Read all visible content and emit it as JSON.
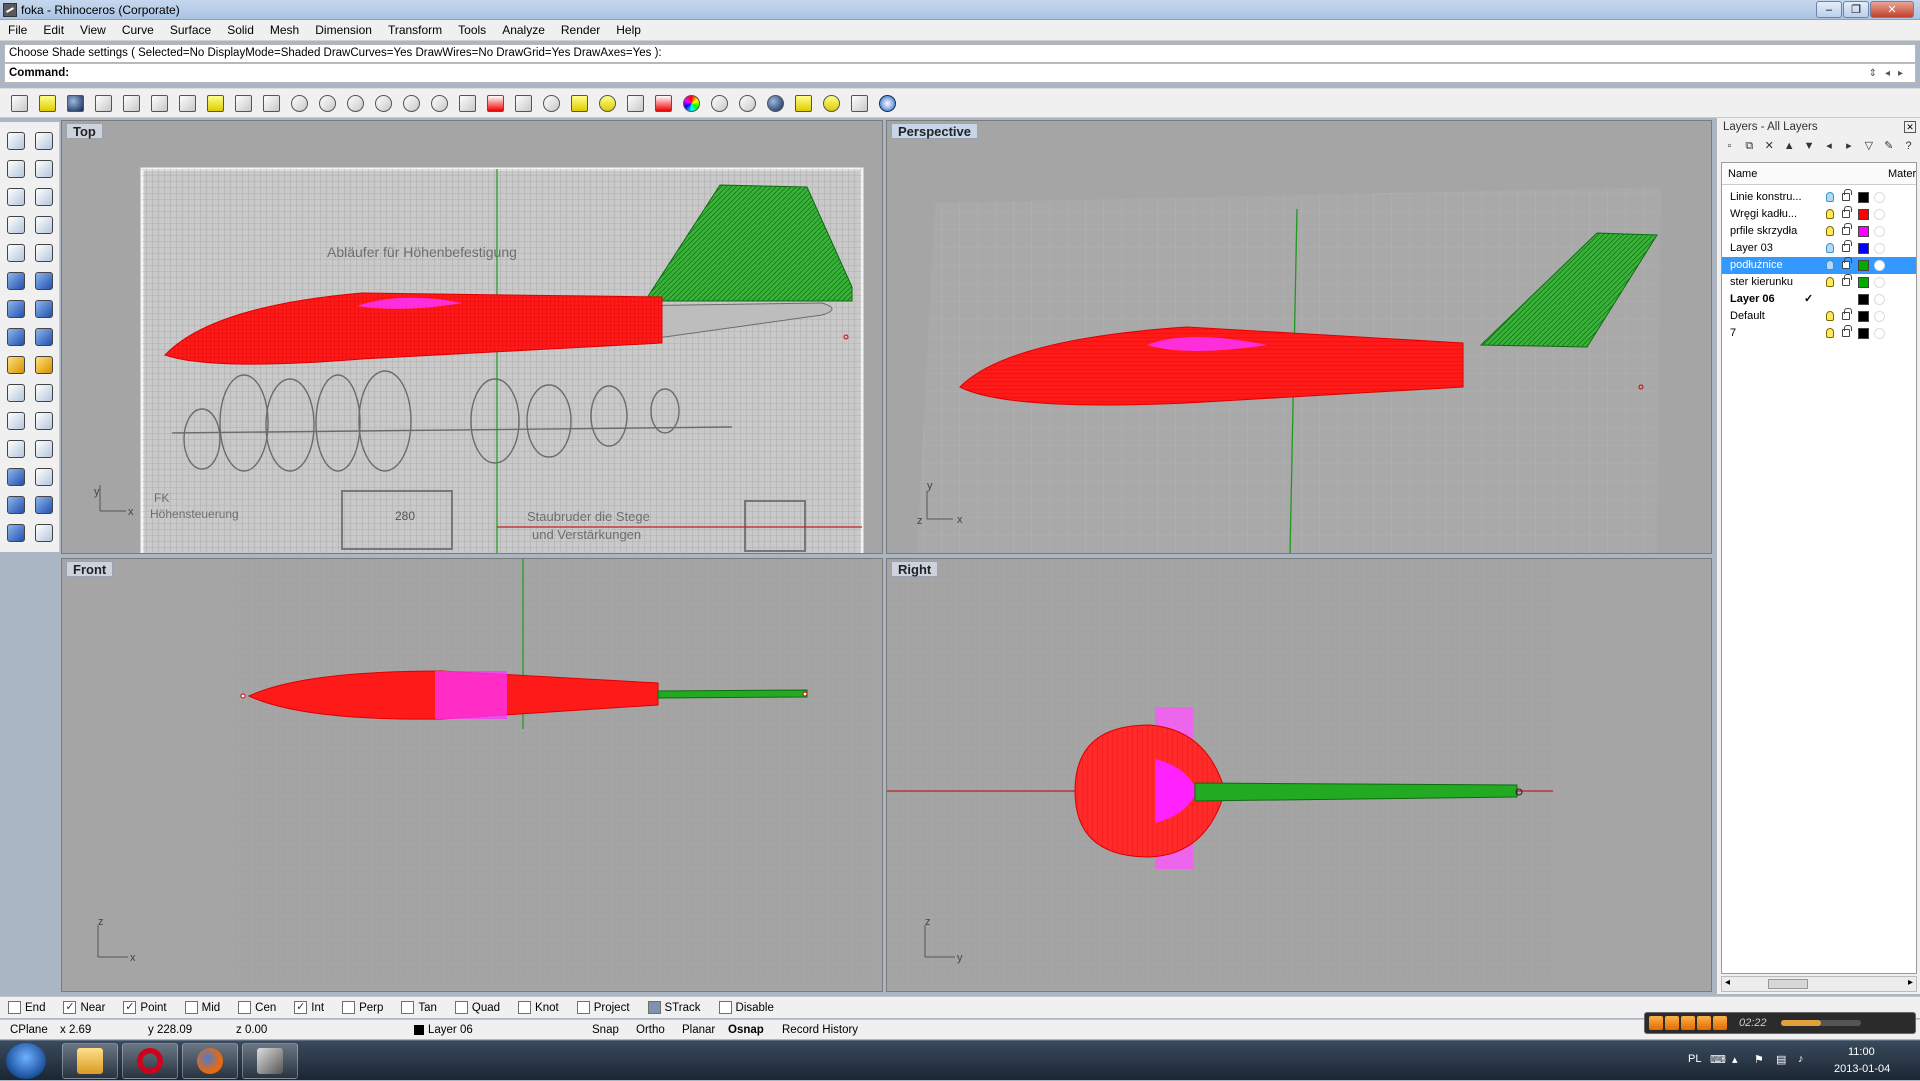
{
  "window": {
    "title": "foka - Rhinoceros (Corporate)",
    "controls": [
      "–",
      "❐",
      "✕"
    ]
  },
  "menu": [
    "File",
    "Edit",
    "View",
    "Curve",
    "Surface",
    "Solid",
    "Mesh",
    "Dimension",
    "Transform",
    "Tools",
    "Analyze",
    "Render",
    "Help"
  ],
  "command": {
    "history": "Choose Shade settings ( Selected=No  DisplayMode=Shaded  DrawCurves=Yes  DrawWires=No  DrawGrid=Yes  DrawAxes=Yes ):",
    "prompt": "Command:"
  },
  "viewports": {
    "top": {
      "label": "Top",
      "axes": [
        "y",
        "x"
      ],
      "blueprint_title": "Abläufer für Höhenbefestigung",
      "blueprint_note1": "FK",
      "blueprint_note2": "Höhensteuerung",
      "blueprint_note3": "Staubruder die Stege",
      "blueprint_note4": "und Verstärkungen",
      "blueprint_dim": "280"
    },
    "perspective": {
      "label": "Perspective",
      "axes": [
        "y",
        "z",
        "x"
      ]
    },
    "front": {
      "label": "Front",
      "axes": [
        "z",
        "x"
      ]
    },
    "right": {
      "label": "Right",
      "axes": [
        "z",
        "y"
      ]
    }
  },
  "colors": {
    "fuselage": "#ff1a1a",
    "fin": "#22aa22",
    "wing": "#ff22ff",
    "viewport_bg": "#a5a5a5",
    "grid": "#b8b8b8",
    "selection": "#3399ff"
  },
  "layers": {
    "title": "Layers - All Layers",
    "columns": {
      "name": "Name",
      "material": "Mater"
    },
    "rows": [
      {
        "name": "Linie konstru...",
        "color": "#000000",
        "bulb": "off",
        "state": ""
      },
      {
        "name": "Wręgi kadłu...",
        "color": "#ff0000",
        "bulb": "on",
        "state": ""
      },
      {
        "name": "prfile skrzydła",
        "color": "#ff00ff",
        "bulb": "on",
        "state": ""
      },
      {
        "name": "Layer 03",
        "color": "#0000ff",
        "bulb": "off",
        "state": ""
      },
      {
        "name": "podłużnice",
        "color": "#00aa00",
        "bulb": "off",
        "state": "selected"
      },
      {
        "name": "ster kierunku",
        "color": "#00aa00",
        "bulb": "on",
        "state": ""
      },
      {
        "name": "Layer 06",
        "color": "#000000",
        "bulb": "",
        "state": "current",
        "check": "✓"
      },
      {
        "name": "Default",
        "color": "#000000",
        "bulb": "on",
        "state": ""
      },
      {
        "name": "7",
        "color": "#000000",
        "bulb": "on",
        "state": ""
      }
    ]
  },
  "osnap": [
    {
      "label": "End",
      "on": false
    },
    {
      "label": "Near",
      "on": true
    },
    {
      "label": "Point",
      "on": true
    },
    {
      "label": "Mid",
      "on": false
    },
    {
      "label": "Cen",
      "on": false
    },
    {
      "label": "Int",
      "on": true
    },
    {
      "label": "Perp",
      "on": false
    },
    {
      "label": "Tan",
      "on": false
    },
    {
      "label": "Quad",
      "on": false
    },
    {
      "label": "Knot",
      "on": false
    },
    {
      "label": "Project",
      "on": false
    },
    {
      "label": "STrack",
      "on": false,
      "filled": true
    },
    {
      "label": "Disable",
      "on": false
    }
  ],
  "status": {
    "cplane": "CPlane",
    "x": "x 2.69",
    "y": "y 228.09",
    "z": "z 0.00",
    "layer": "Layer 06",
    "snap": "Snap",
    "ortho": "Ortho",
    "planar": "Planar",
    "osnap": "Osnap",
    "record_history": "Record History"
  },
  "media": {
    "time": "02:22"
  },
  "tray": {
    "lang": "PL",
    "time": "11:00",
    "date": "2013-01-04"
  }
}
